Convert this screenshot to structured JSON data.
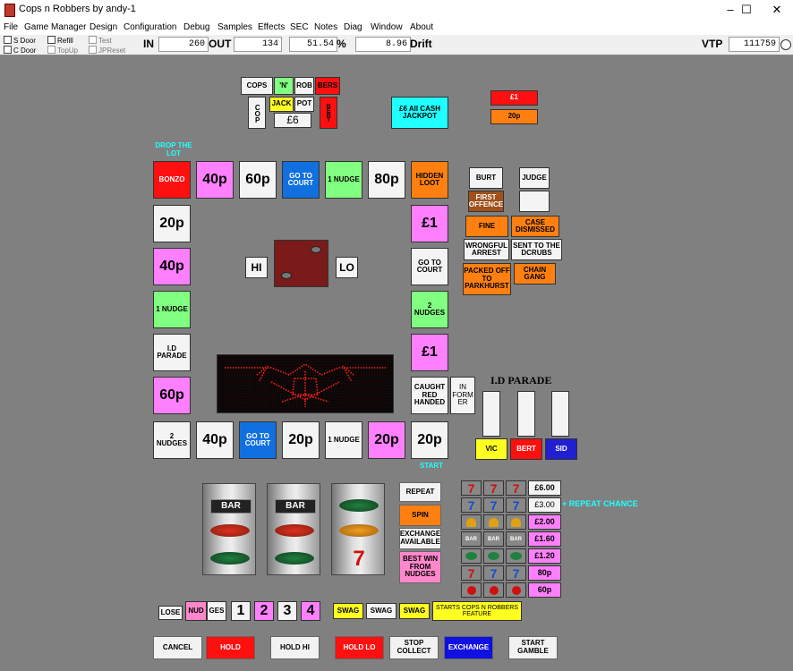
{
  "window": {
    "title": "Cops n Robbers by andy-1",
    "minimize": "–",
    "maximize": "☐",
    "close": "✕"
  },
  "menu": [
    "File",
    "Game Manager",
    "Design",
    "Configuration",
    "Debug",
    "Samples",
    "Effects",
    "SEC",
    "Notes",
    "Diag",
    "Window",
    "About"
  ],
  "toolbar": {
    "s_door": "S Door",
    "c_door": "C Door",
    "refill": "Refill",
    "topup": "TopUp",
    "test": "Test",
    "jpreset": "JPReset",
    "in_label": "IN",
    "in_value": "260",
    "out_label": "OUT",
    "out_value": "134",
    "pct_value": "51.54",
    "pct_label": "%",
    "drift_value": "8.96",
    "drift_label": "Drift",
    "vtp_label": "VTP",
    "vtp_value": "111759"
  },
  "top": {
    "cops": "COPS",
    "n": "'N'",
    "rob": "ROB",
    "bers": "BERS",
    "cop": "COP",
    "jack": "JACK",
    "pot": "POT",
    "six": "£6",
    "bert_v": "BERT",
    "cash_jackpot": "£6 All CASH JACKPOT",
    "stake_1": "£1",
    "stake_20p": "20p"
  },
  "board": {
    "drop_the_lot": "DROP THE LOT",
    "top_row": [
      "BONZO",
      "40p",
      "60p",
      "GO TO COURT",
      "1 NUDGE",
      "80p",
      "HIDDEN LOOT"
    ],
    "left_col": [
      "20p",
      "40p",
      "1 NUDGE",
      "I.D PARADE",
      "60p"
    ],
    "right_col": [
      "£1",
      "GO TO COURT",
      "2 NUDGES",
      "£1",
      "CAUGHT RED HANDED"
    ],
    "bottom_row": [
      "2 NUDGES",
      "40p",
      "GO TO COURT",
      "20p",
      "1 NUDGE",
      "20p",
      "20p"
    ],
    "informer": "IN FORM ER",
    "start": "START",
    "hi": "HI",
    "lo": "LO"
  },
  "court": {
    "burt": "BURT",
    "judge": "JUDGE",
    "first_offence": "FIRST OFFENCE",
    "fine": "FINE",
    "case_dismissed": "CASE DISMISSED",
    "wrongful_arrest": "WRONGFUL ARREST",
    "sent_to_dcrubs": "SENT TO THE DCRUBS",
    "packed_off": "PACKED OFF TO PARKHURST",
    "chain_gang": "CHAIN GANG"
  },
  "id_parade": {
    "title": "I.D PARADE",
    "vic": "VIC",
    "bert": "BERT",
    "sid": "SID"
  },
  "reels": {
    "bar": "BAR"
  },
  "controls_side": {
    "repeat": "REPEAT",
    "spin": "SPIN",
    "exchange_available": "EXCHANGE AVAILABLE",
    "best_win": "BEST WIN FROM NUDGES"
  },
  "paytable": {
    "prizes": [
      "£6.00",
      "£3.00",
      "£2.00",
      "£1.60",
      "£1.20",
      "80p",
      "60p"
    ],
    "repeat_chance": "+ REPEAT CHANCE"
  },
  "nudges": {
    "lose": "LOSE",
    "nud": "NUD",
    "ges": "GES",
    "n1": "1",
    "n2": "2",
    "n3": "3",
    "n4": "4"
  },
  "swag": {
    "s1": "SWAG",
    "s2": "SWAG",
    "s3": "SWAG",
    "feature": "STARTS COPS N ROBBERS FEATURE"
  },
  "buttons": {
    "cancel": "CANCEL",
    "hold": "HOLD",
    "hold_hi": "HOLD HI",
    "hold_lo": "HOLD LO",
    "stop_collect": "STOP COLLECT",
    "exchange": "EXCHANGE",
    "start_gamble": "START GAMBLE"
  },
  "colors": {
    "background": "#808080",
    "cyan_text": "#20ffff",
    "dot_matrix": "#ff2020"
  }
}
